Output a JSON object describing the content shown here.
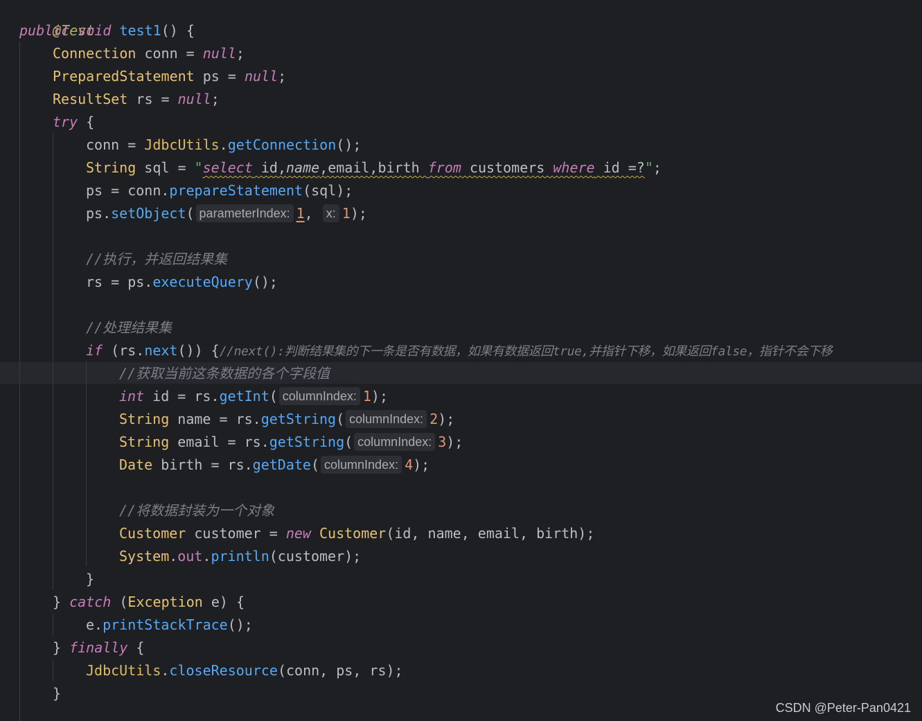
{
  "code": {
    "l1": {
      "annotation": "@Test"
    },
    "l2": {
      "public": "public",
      "void": "void",
      "method": "test1",
      "rest": "() {"
    },
    "l3": {
      "type": "Connection",
      "rest": " conn = ",
      "null": "null",
      "end": ";"
    },
    "l4": {
      "type": "PreparedStatement",
      "rest": " ps = ",
      "null": "null",
      "end": ";"
    },
    "l5": {
      "type": "ResultSet",
      "rest": " rs = ",
      "null": "null",
      "end": ";"
    },
    "l6": {
      "try": "try",
      "rest": " {"
    },
    "l7": {
      "a": "conn = ",
      "cls": "JdbcUtils",
      "dot": ".",
      "fn": "getConnection",
      "end": "();"
    },
    "l8": {
      "type": "String",
      "a": " sql = ",
      "q1": "\"",
      "select": "select",
      "id1": " id,",
      "name": "name",
      "cols": ",email,birth ",
      "from": "from",
      "tbl": " customers ",
      "where": "where",
      "cond": " id =?",
      "q2": "\"",
      "end": ";"
    },
    "l9": {
      "a": "ps = conn.",
      "fn": "prepareStatement",
      "end": "(sql);"
    },
    "l10": {
      "a": "ps.",
      "fn": "setObject",
      "p": "(",
      "hint1": "parameterIndex:",
      "v1": "1",
      "comma": ",",
      "hint2": "x:",
      "v2": "1",
      "end": ");"
    },
    "l12": {
      "comment": "//执行，并返回结果集"
    },
    "l13": {
      "a": "rs = ps.",
      "fn": "executeQuery",
      "end": "();"
    },
    "l15": {
      "comment": "//处理结果集"
    },
    "l16": {
      "if": "if",
      "a": " (rs.",
      "fn": "next",
      "b": "()) {",
      "comment": "//next():判断结果集的下一条是否有数据，如果有数据返回true,并指针下移，如果返回false，指针不会下移"
    },
    "l17": {
      "comment": "//获取当前这条数据的各个字段值"
    },
    "l18": {
      "type": "int",
      "a": " id = rs.",
      "fn": "getInt",
      "p": "(",
      "hint": "columnIndex:",
      "v": "1",
      "end": ");"
    },
    "l19": {
      "type": "String",
      "a": " name = rs.",
      "fn": "getString",
      "p": "(",
      "hint": "columnIndex:",
      "v": "2",
      "end": ");"
    },
    "l20": {
      "type": "String",
      "a": " email = rs.",
      "fn": "getString",
      "p": "(",
      "hint": "columnIndex:",
      "v": "3",
      "end": ");"
    },
    "l21": {
      "type": "Date",
      "a": " birth = rs.",
      "fn": "getDate",
      "p": "(",
      "hint": "columnIndex:",
      "v": "4",
      "end": ");"
    },
    "l23": {
      "comment": "//将数据封装为一个对象"
    },
    "l24": {
      "type": "Customer",
      "a": " customer = ",
      "new": "new",
      "cls": " Customer",
      "end": "(id, name, email, birth);"
    },
    "l25": {
      "cls": "System",
      "dot": ".",
      "field": "out",
      "dot2": ".",
      "fn": "println",
      "end": "(customer);"
    },
    "l26": {
      "brace": "}"
    },
    "l27": {
      "a": "} ",
      "catch": "catch",
      "b": " (",
      "type": "Exception",
      "c": " e) {"
    },
    "l28": {
      "a": "e.",
      "fn": "printStackTrace",
      "end": "();"
    },
    "l29": {
      "a": "} ",
      "finally": "finally",
      "b": " {"
    },
    "l30": {
      "cls": "JdbcUtils",
      "dot": ".",
      "fn": "closeResource",
      "end": "(conn, ps, rs);"
    },
    "l31": {
      "brace": "}"
    }
  },
  "watermark": "CSDN @Peter-Pan0421"
}
